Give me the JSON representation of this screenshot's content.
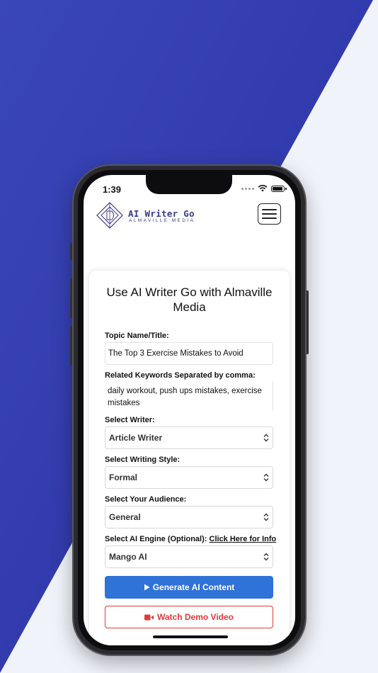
{
  "colors": {
    "background_blue": "#2e34a8",
    "background_light": "#f1f3fb",
    "brand": "#3a3a8c",
    "primary_button": "#2f72d8",
    "demo_button": "#e03a3a"
  },
  "status_bar": {
    "time": "1:39",
    "icons": [
      "cellular-dots-icon",
      "wifi-icon",
      "battery-icon"
    ]
  },
  "header": {
    "logo_title": "AI Writer Go",
    "logo_subtitle": "ALMAVILLE MEDIA",
    "menu_icon": "hamburger-menu-icon"
  },
  "form": {
    "title": "Use AI Writer Go with Almaville Media",
    "topic_label": "Topic Name/Title:",
    "topic_value": "The Top 3 Exercise Mistakes to Avoid",
    "keywords_label": "Related Keywords Separated by comma:",
    "keywords_value": "daily workout, push ups mistakes, exercise mistakes",
    "writer_label": "Select Writer:",
    "writer_value": "Article Writer",
    "style_label": "Select Writing Style:",
    "style_value": "Formal",
    "audience_label": "Select Your Audience:",
    "audience_value": "General",
    "engine_label": "Select AI Engine (Optional):",
    "engine_link": "Click Here for Info",
    "engine_value": "Mango AI",
    "generate_label": "Generate AI Content",
    "demo_label": "Watch Demo Video"
  }
}
